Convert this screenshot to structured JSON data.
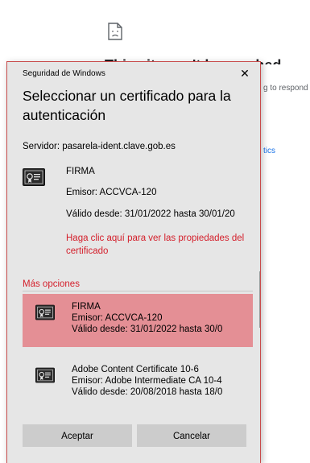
{
  "background": {
    "error_icon": "sad-page-icon",
    "title": "This site can't be reached",
    "respond_text": "g to respond",
    "link_text": "tics"
  },
  "dialog": {
    "caption": "Seguridad de Windows",
    "close_glyph": "✕",
    "heading": "Seleccionar un certificado para la autenticación",
    "server": "Servidor: pasarela-ident.clave.gob.es",
    "selected_certificate": {
      "icon": "certificate-icon",
      "name": "FIRMA",
      "issuer": "Emisor: ACCVCA-120",
      "valid": "Válido desde: 31/01/2022 hasta 30/01/20",
      "properties_link": "Haga clic aquí para ver las propiedades del certificado"
    },
    "more_options": "Más opciones",
    "options": [
      {
        "name": "FIRMA",
        "issuer": "Emisor: ACCVCA-120",
        "valid": "Válido desde: 31/01/2022 hasta 30/0",
        "selected": true
      },
      {
        "name": "Adobe Content Certificate 10-6",
        "issuer": "Emisor: Adobe Intermediate CA 10-4",
        "valid": "Válido desde: 20/08/2018 hasta 18/0",
        "selected": false
      }
    ],
    "accept_label": "Aceptar",
    "cancel_label": "Cancelar"
  },
  "colors": {
    "accent_red": "#d4202c",
    "selected_bg": "#e48f95",
    "dialog_bg": "#e6e6e6"
  }
}
